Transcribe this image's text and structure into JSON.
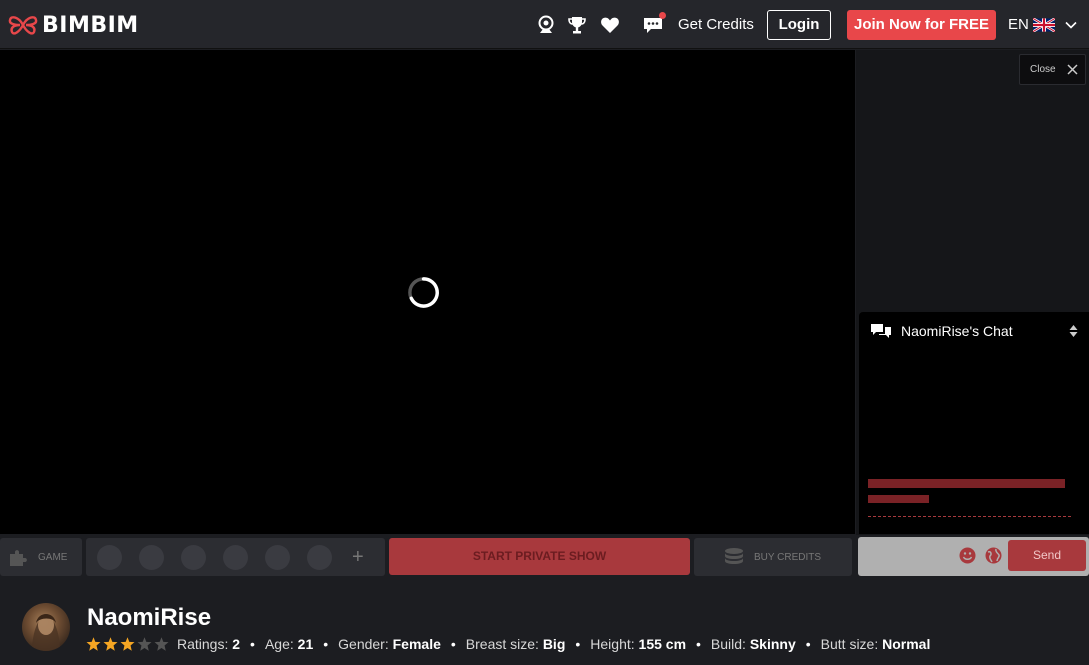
{
  "header": {
    "logo_text": "BIMBIM",
    "get_credits": "Get Credits",
    "login": "Login",
    "join": "Join Now for FREE",
    "language": "EN",
    "icons": [
      "webcam-icon",
      "trophy-icon",
      "heart-icon",
      "messages-icon"
    ]
  },
  "player": {
    "close_label": "Close"
  },
  "chat": {
    "title": "NaomiRise's Chat",
    "send_label": "Send"
  },
  "controls": {
    "game_label": "GAME",
    "tip_add": "+",
    "private_show": "START PRIVATE SHOW",
    "buy_credits": "BUY CREDITS"
  },
  "model": {
    "name": "NaomiRise",
    "rating_stars": 3,
    "rating_max": 5,
    "stats": [
      {
        "label": "Ratings:",
        "value": "2"
      },
      {
        "label": "Age:",
        "value": "21"
      },
      {
        "label": "Gender:",
        "value": "Female"
      },
      {
        "label": "Breast size:",
        "value": "Big"
      },
      {
        "label": "Height:",
        "value": "155 cm"
      },
      {
        "label": "Build:",
        "value": "Skinny"
      },
      {
        "label": "Butt size:",
        "value": "Normal"
      }
    ],
    "separator": "•"
  },
  "colors": {
    "accent": "#e8474a",
    "dark_accent": "#a8393d",
    "star_on": "#f5a623",
    "star_off": "#555555"
  }
}
